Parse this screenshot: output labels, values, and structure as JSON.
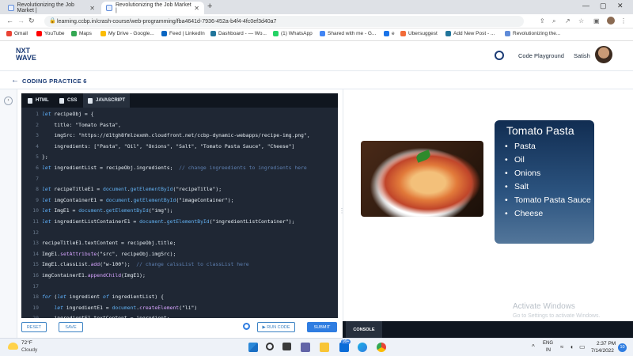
{
  "browser": {
    "tabs": [
      {
        "title": "Revolutionizing the Job Market |",
        "active": false
      },
      {
        "title": "Revolutionizing the Job Market |",
        "active": true
      }
    ],
    "new_tab": "+",
    "url": "learning.ccbp.in/crash-course/web-programming/fba4641d-7936-452a-b4f4-4fc0ef3d40a7"
  },
  "bookmarks": [
    {
      "label": "Gmail",
      "color": "#ea4335"
    },
    {
      "label": "YouTube",
      "color": "#ff0000"
    },
    {
      "label": "Maps",
      "color": "#34a853"
    },
    {
      "label": "My Drive - Google...",
      "color": "#fbbc04"
    },
    {
      "label": "Feed | LinkedIn",
      "color": "#0a66c2"
    },
    {
      "label": "Dashboard - — Wo...",
      "color": "#21759b"
    },
    {
      "label": "(1) WhatsApp",
      "color": "#25d366"
    },
    {
      "label": "Shared with me - G...",
      "color": "#4285f4"
    },
    {
      "label": "e",
      "color": "#1a73e8"
    },
    {
      "label": "Ubersuggest",
      "color": "#f26b38"
    },
    {
      "label": "Add New Post - ...",
      "color": "#21759b"
    },
    {
      "label": "Revolutionizing the...",
      "color": "#5f8bd8"
    }
  ],
  "header": {
    "logo_line1": "NXT",
    "logo_line2": "WAVE",
    "playground": "Code Playground",
    "username": "Satish"
  },
  "breadcrumb": {
    "back_icon": "←",
    "title": "CODING PRACTICE 6"
  },
  "editor": {
    "tabs": [
      "HTML",
      "CSS",
      "JAVASCRIPT"
    ],
    "active_tab": "JAVASCRIPT",
    "lines": [
      {
        "n": "1",
        "html": "<span class=\"kw\">let</span> recipeObj = {"
      },
      {
        "n": "2",
        "html": "    title: \"Tomato Pasta\","
      },
      {
        "n": "3",
        "html": "    imgSrc: \"https://d1tgh8fmlzexmh.cloudfront.net/ccbp-dynamic-webapps/recipe-img.png\","
      },
      {
        "n": "4",
        "html": "    ingredients: [\"Pasta\", \"Oil\", \"Onions\", \"Salt\", \"Tomato Pasta Sauce\", \"Cheese\"]"
      },
      {
        "n": "5",
        "html": "};"
      },
      {
        "n": "6",
        "html": "<span class=\"kw\">let</span> ingredientList = recipeObj.ingredients;  <span class=\"cm\">// change ingreedients to ingredients here</span>"
      },
      {
        "n": "7",
        "html": ""
      },
      {
        "n": "8",
        "html": "<span class=\"kw\">let</span> recipeTitleE1 = <span class=\"fn\">document</span>.<span class=\"fn\">getElementById</span>(\"recipeTitle\");"
      },
      {
        "n": "9",
        "html": "<span class=\"kw\">let</span> imgContainerE1 = <span class=\"fn\">document</span>.<span class=\"fn\">getElementById</span>(\"imageContainer\");"
      },
      {
        "n": "10",
        "html": "<span class=\"kw\">let</span> ImgE1 = <span class=\"fn\">document</span>.<span class=\"fn\">getElementById</span>(\"img\");"
      },
      {
        "n": "11",
        "html": "<span class=\"kw\">let</span> ingredientListContainerE1 = <span class=\"fn\">document</span>.<span class=\"fn\">getElementById</span>(\"ingredientListContainer\");"
      },
      {
        "n": "12",
        "html": ""
      },
      {
        "n": "13",
        "html": "recipeTitleE1.textContent = recipeObj.title;"
      },
      {
        "n": "14",
        "html": "ImgE1.<span class=\"mth\">setAttribute</span>(\"src\", recipeObj.imgSrc);"
      },
      {
        "n": "15",
        "html": "ImgE1.classList.<span class=\"mth\">add</span>(\"w-100\");  <span class=\"cm\">// change calssList to classList here</span>"
      },
      {
        "n": "16",
        "html": "imgContainerE1.<span class=\"mth\">appendChild</span>(ImgE1);"
      },
      {
        "n": "17",
        "html": ""
      },
      {
        "n": "18",
        "html": "<span class=\"kw\">for</span> (<span class=\"kw\">let</span> ingredient <span class=\"kw\">of</span> ingredientList) {"
      },
      {
        "n": "19",
        "html": "    <span class=\"kw\">let</span> ingredientE1 = <span class=\"fn\">document</span>.<span class=\"mth\">createElement</span>(\"li\")"
      },
      {
        "n": "20",
        "html": "    ingredientE1.textContent = ingredient;"
      }
    ],
    "reset": "RESET",
    "save": "SAVE",
    "run": "▶ RUN CODE",
    "submit": "SUBMIT"
  },
  "output": {
    "recipe_title": "Tomato Pasta",
    "ingredients": [
      "Pasta",
      "Oil",
      "Onions",
      "Salt",
      "Tomato Pasta Sauce",
      "Cheese"
    ],
    "watermark_title": "Activate Windows",
    "watermark_sub": "Go to Settings to activate Windows.",
    "console_tab": "CONSOLE"
  },
  "taskbar": {
    "temp": "72°F",
    "weather": "Cloudy",
    "lang1": "ENG",
    "lang2": "IN",
    "time": "2:37 PM",
    "date": "7/14/2022",
    "notif": "10",
    "mail_badge": "99+"
  }
}
